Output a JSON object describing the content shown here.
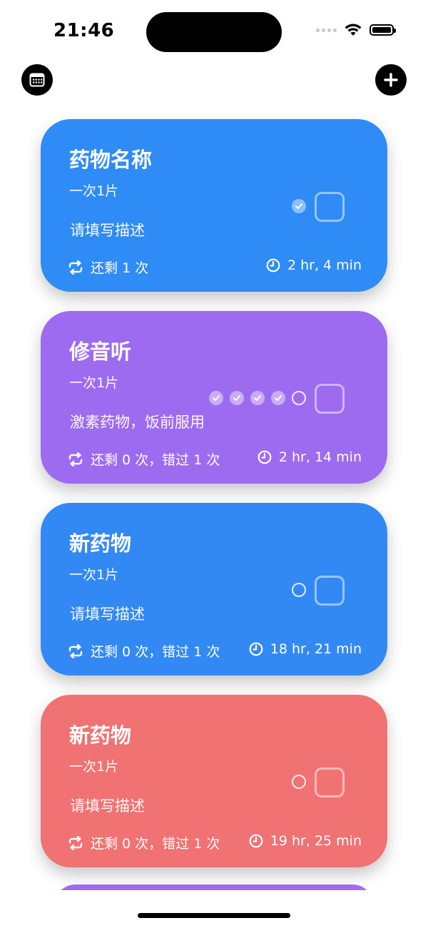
{
  "status_bar": {
    "time": "21:46"
  },
  "toolbar": {
    "calendar_icon": "calendar-icon",
    "add_icon": "plus-icon"
  },
  "cards": [
    {
      "title": "药物名称",
      "dose": "一次1片",
      "description": "请填写描述",
      "remaining": "还剩 1 次",
      "countdown": "2 hr, 4 min",
      "color": "#2f8bf5",
      "dots": [
        "done"
      ]
    },
    {
      "title": "修音听",
      "dose": "一次1片",
      "description": "激素药物，饭前服用",
      "remaining": "还剩 0 次，错过 1 次",
      "countdown": "2 hr, 14 min",
      "color": "#9d6bef",
      "dots": [
        "done",
        "done",
        "done",
        "done",
        "empty"
      ]
    },
    {
      "title": "新药物",
      "dose": "一次1片",
      "description": "请填写描述",
      "remaining": "还剩 0 次，错过 1 次",
      "countdown": "18 hr, 21 min",
      "color": "#3389f3",
      "dots": [
        "empty"
      ]
    },
    {
      "title": "新药物",
      "dose": "一次1片",
      "description": "请填写描述",
      "remaining": "还剩 0 次，错过 1 次",
      "countdown": "19 hr, 25 min",
      "color": "#f07272",
      "dots": [
        "empty"
      ]
    }
  ]
}
